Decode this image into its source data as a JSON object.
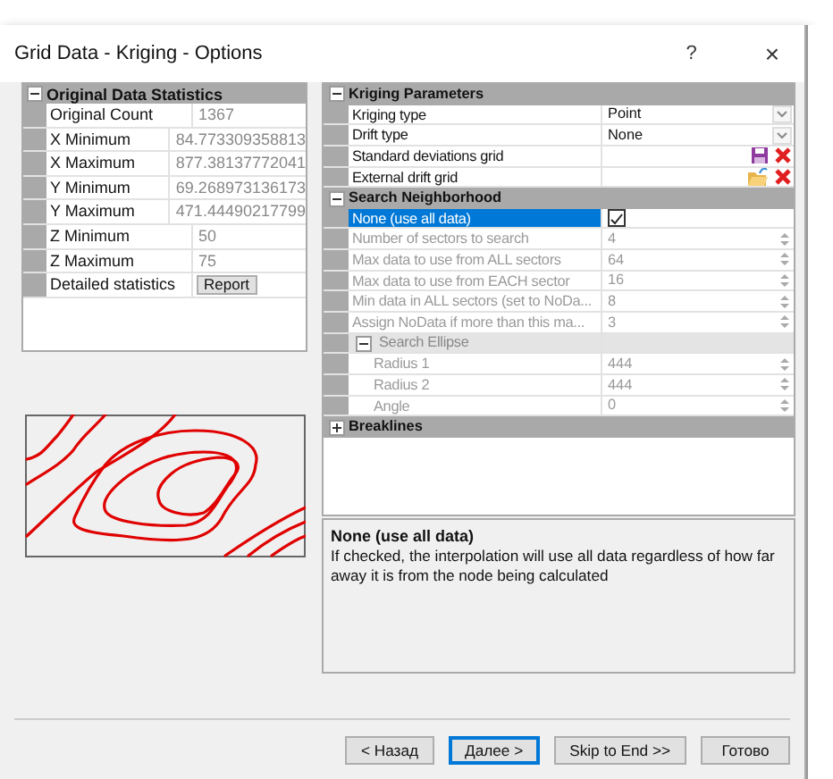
{
  "window": {
    "title": "Grid Data - Kriging - Options",
    "help": "?",
    "close": "×"
  },
  "statistics": {
    "title": "Original Data Statistics",
    "expanded": true,
    "rows": [
      {
        "label": "Original Count",
        "value": "1367"
      },
      {
        "label": "X Minimum",
        "value": "84.773309358813"
      },
      {
        "label": "X Maximum",
        "value": "877.38137772041"
      },
      {
        "label": "Y Minimum",
        "value": "69.268973136173"
      },
      {
        "label": "Y Maximum",
        "value": "471.44490217799"
      },
      {
        "label": "Z Minimum",
        "value": "50"
      },
      {
        "label": "Z Maximum",
        "value": "75"
      }
    ],
    "report": {
      "label": "Detailed statistics",
      "button": "Report"
    }
  },
  "parameters": [
    {
      "title": "Kriging Parameters",
      "expanded": true,
      "rows": [
        {
          "kind": "dropdown",
          "label": "Kriging type",
          "value": "Point",
          "selected": false,
          "disabled": false
        },
        {
          "kind": "dropdown",
          "label": "Drift type",
          "value": "None",
          "selected": false,
          "disabled": false
        },
        {
          "kind": "save",
          "label": "Standard deviations grid",
          "selected": false,
          "disabled": false
        },
        {
          "kind": "open",
          "label": "External drift grid",
          "selected": false,
          "disabled": false
        }
      ]
    },
    {
      "title": "Search Neighborhood",
      "expanded": true,
      "rows": [
        {
          "kind": "check",
          "label": "None (use all data)",
          "checked": true,
          "selected": true,
          "disabled": false
        },
        {
          "kind": "spin",
          "label": "Number of sectors to search",
          "value": "4",
          "selected": false,
          "disabled": true
        },
        {
          "kind": "spin",
          "label": "Max data to use from ALL sectors",
          "value": "64",
          "selected": false,
          "disabled": true
        },
        {
          "kind": "spin",
          "label": "Max data to use from EACH sector",
          "value": "16",
          "selected": false,
          "disabled": true
        },
        {
          "kind": "spin",
          "label": "Min data in ALL sectors (set to NoDa...",
          "value": "8",
          "selected": false,
          "disabled": true
        },
        {
          "kind": "spin",
          "label": "Assign NoData if more than this ma...",
          "value": "3",
          "selected": false,
          "disabled": true
        },
        {
          "kind": "group",
          "label": "Search Ellipse",
          "expanded": true,
          "children": [
            {
              "kind": "spin",
              "label": "Radius 1",
              "value": "444",
              "selected": false,
              "disabled": true
            },
            {
              "kind": "spin",
              "label": "Radius 2",
              "value": "444",
              "selected": false,
              "disabled": true
            },
            {
              "kind": "spin",
              "label": "Angle",
              "value": "0",
              "selected": false,
              "disabled": true
            }
          ]
        }
      ]
    },
    {
      "title": "Breaklines",
      "expanded": false
    }
  ],
  "description": {
    "title": "None (use all data)",
    "text": "If checked, the interpolation will use all data regardless of how far away it is from the node being calculated"
  },
  "buttons": [
    {
      "label": "< Назад",
      "default": false
    },
    {
      "label": "Далее >",
      "default": true
    },
    {
      "label": "Skip to End >>",
      "default": false
    },
    {
      "label": "Готово",
      "default": false
    }
  ]
}
